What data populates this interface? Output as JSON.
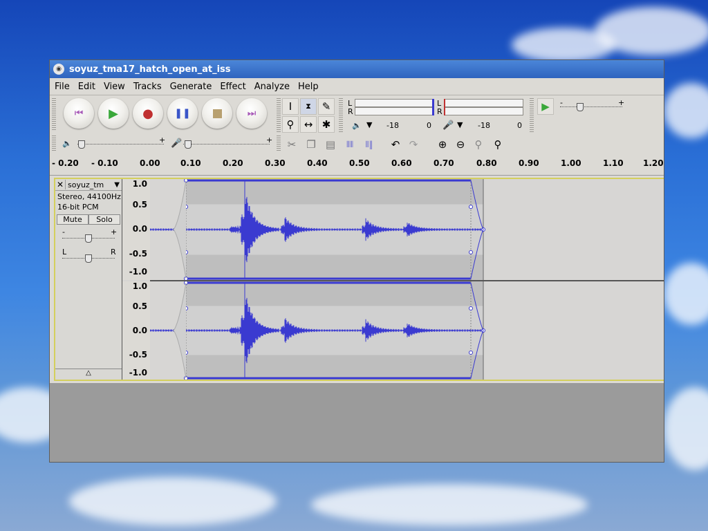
{
  "window": {
    "title": "soyuz_tma17_hatch_open_at_iss"
  },
  "menu": [
    "File",
    "Edit",
    "View",
    "Tracks",
    "Generate",
    "Effect",
    "Analyze",
    "Help"
  ],
  "meters": {
    "play_L": "L",
    "play_R": "R",
    "rec_L": "L",
    "rec_R": "R",
    "play_ticks": [
      "-18",
      "0"
    ],
    "rec_ticks": [
      "-18",
      "0"
    ]
  },
  "mixer": {
    "output_plus": "+",
    "input_plus": "+",
    "playback_minus": "-",
    "playback_plus": "+"
  },
  "ruler": {
    "ticks": [
      "- 0.20",
      "- 0.10",
      "0.00",
      "0.10",
      "0.20",
      "0.30",
      "0.40",
      "0.50",
      "0.60",
      "0.70",
      "0.80",
      "0.90",
      "1.00",
      "1.10",
      "1.20"
    ]
  },
  "track": {
    "name": "soyuz_tm",
    "format": "Stereo, 44100Hz",
    "bits": "16-bit PCM",
    "mute": "Mute",
    "solo": "Solo",
    "gain_minus": "-",
    "gain_plus": "+",
    "pan_left": "L",
    "pan_right": "R",
    "vscale": [
      "1.0",
      "0.5",
      "0.0",
      "-0.5",
      "-1.0"
    ]
  },
  "colors": {
    "waveform": "#3a3ad0",
    "selection": "#bebebe",
    "track_border": "#d4cf5c"
  }
}
